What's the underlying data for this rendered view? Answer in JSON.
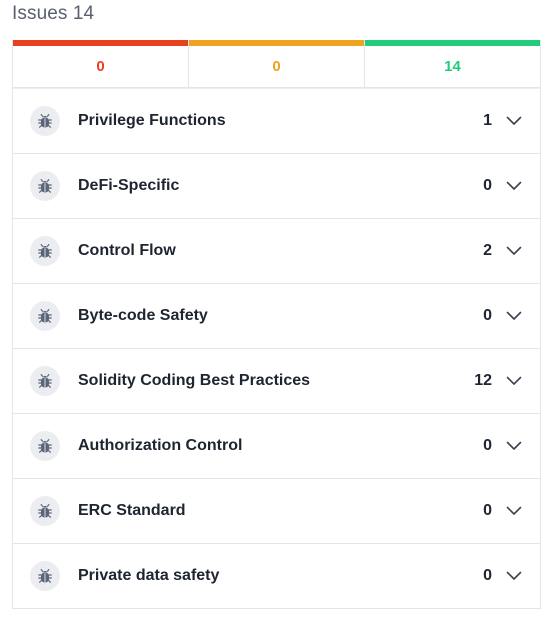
{
  "header": {
    "title": "Issues 14"
  },
  "summary": [
    {
      "value": "0",
      "color": "#e8411f",
      "bar_color": "#e8411f"
    },
    {
      "value": "0",
      "color": "#efa321",
      "bar_color": "#efa321"
    },
    {
      "value": "14",
      "color": "#22cc7a",
      "bar_color": "#22cc7a"
    }
  ],
  "categories": [
    {
      "label": "Privilege Functions",
      "count": "1",
      "icon": "bug-icon"
    },
    {
      "label": "DeFi-Specific",
      "count": "0",
      "icon": "bug-icon"
    },
    {
      "label": "Control Flow",
      "count": "2",
      "icon": "bug-icon"
    },
    {
      "label": "Byte-code Safety",
      "count": "0",
      "icon": "bug-icon"
    },
    {
      "label": "Solidity Coding Best Practices",
      "count": "12",
      "icon": "bug-icon"
    },
    {
      "label": "Authorization Control",
      "count": "0",
      "icon": "bug-icon"
    },
    {
      "label": "ERC Standard",
      "count": "0",
      "icon": "bug-icon"
    },
    {
      "label": "Private data safety",
      "count": "0",
      "icon": "bug-icon"
    }
  ]
}
